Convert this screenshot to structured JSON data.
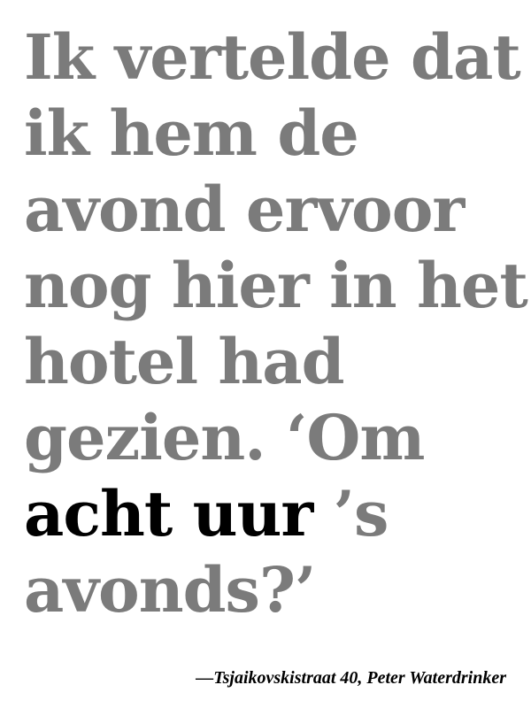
{
  "quote": {
    "lines": [
      "Ik vertelde dat",
      "ik hem de",
      "avond ervoor",
      "nog hier in het",
      "hotel had",
      "gezien. ‘Om"
    ],
    "emphasis": "acht uur",
    "emphasis_tail": " ’s",
    "last_line": "avonds?’"
  },
  "attribution": "—Tsjaikovskistraat 40, Peter Waterdrinker",
  "colors": {
    "quote_text": "#7b7b7b",
    "emphasis_text": "#000000",
    "background": "#ffffff"
  }
}
